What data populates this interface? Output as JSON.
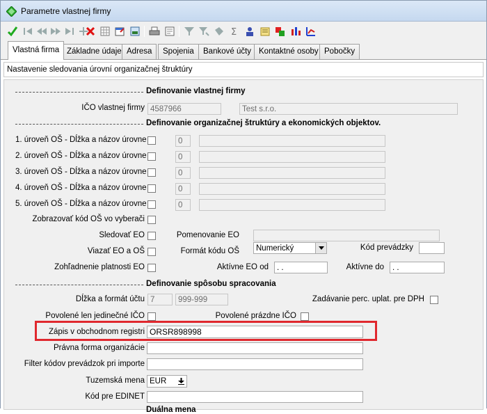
{
  "window": {
    "title": "Parametre vlastnej firmy"
  },
  "tabs": [
    "Vlastná firma",
    "Základne údaje",
    "Adresa",
    "Spojenia",
    "Bankové účty",
    "Kontaktné osoby",
    "Pobočky"
  ],
  "subtitle": "Nastavenie sledovania úrovní organizačnej štruktúry",
  "dashes": "----------------------------------------------------",
  "section1": {
    "title": "Definovanie vlastnej firmy",
    "ico_label": "IČO vlastnej firmy",
    "ico_value": "4587966",
    "name_value": "Test s.r.o."
  },
  "section2": {
    "title": "Definovanie organizačnej štruktúry a ekonomických objektov.",
    "levels": [
      {
        "label": "1. úroveň OŠ - Dĺžka a názov úrovne",
        "length": "0",
        "name": ""
      },
      {
        "label": "2. úroveň OŠ - Dĺžka a názov úrovne",
        "length": "0",
        "name": ""
      },
      {
        "label": "3. úroveň OŠ - Dĺžka a názov úrovne",
        "length": "0",
        "name": ""
      },
      {
        "label": "4. úroveň OŠ - Dĺžka a názov úrovne",
        "length": "0",
        "name": ""
      },
      {
        "label": "5. úroveň OŠ - Dĺžka a názov úrovne",
        "length": "0",
        "name": ""
      }
    ],
    "show_code_label": "Zobrazovať kód OŠ vo vyberači",
    "track_eo_label": "Sledovať EO",
    "eo_name_label": "Pomenovanie EO",
    "eo_name_value": "",
    "bind_label": "Viazať EO a OŠ",
    "code_format_label": "Formát kódu OŠ",
    "code_format_value": "Numerický",
    "branch_code_label": "Kód prevádzky",
    "branch_code_value": "",
    "validity_label": "Zohľadnenie platnosti EO",
    "active_from_label": "Aktívne EO od",
    "active_from_value": " .  .",
    "active_to_label": "Aktívne do",
    "active_to_value": " .  ."
  },
  "section3": {
    "title": "Definovanie spôsobu spracovania",
    "account_len_label": "Dĺžka a formát účtu",
    "account_len_value": "7",
    "account_fmt_value": "999-999",
    "dph_label": "Zadávanie perc. uplat. pre DPH",
    "unique_ico_label": "Povolené len jedinečné IČO",
    "empty_ico_label": "Povolené prázdne IČO",
    "register_label": "Zápis v obchodnom registri",
    "register_value": "ORSR898998",
    "legal_form_label": "Právna forma organizácie",
    "legal_form_value": "",
    "filter_label": "Filter kódov prevádzok pri importe",
    "filter_value": "",
    "currency_label": "Tuzemská mena",
    "currency_value": "EUR",
    "edinet_label": "Kód pre EDINET",
    "edinet_value": "",
    "dual_currency_label": "Duálna mena"
  }
}
